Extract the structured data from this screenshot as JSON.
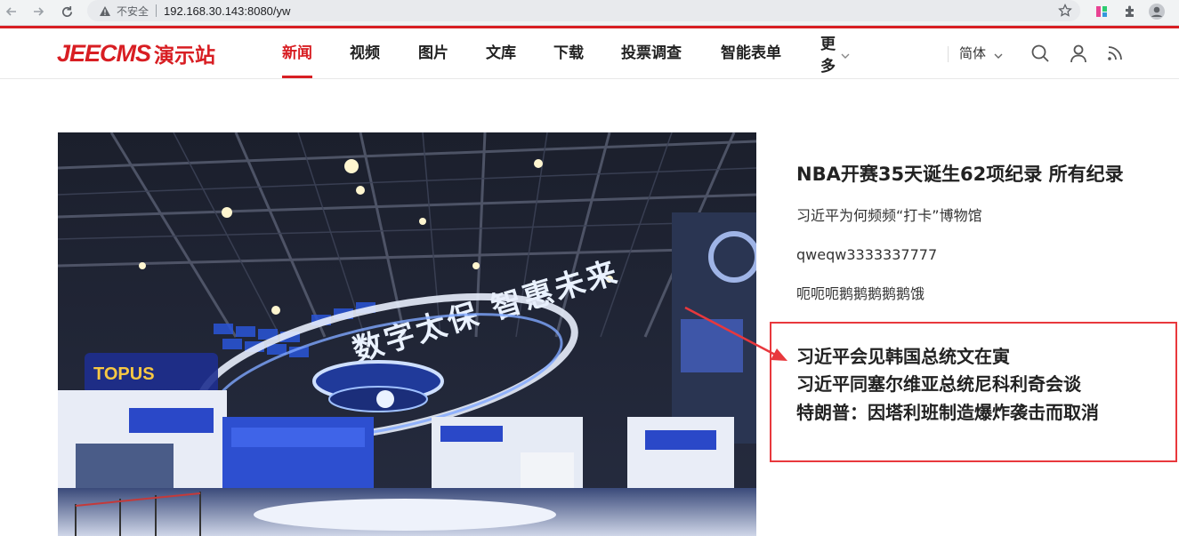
{
  "browser": {
    "security_label": "不安全",
    "url": "192.168.30.143:8080/yw"
  },
  "site": {
    "logo_en": "JEECMS",
    "logo_cn": "演示站",
    "brand_color": "#d81e23"
  },
  "nav": {
    "items": [
      {
        "label": "新闻",
        "active": true
      },
      {
        "label": "视频"
      },
      {
        "label": "图片"
      },
      {
        "label": "文库"
      },
      {
        "label": "下载"
      },
      {
        "label": "投票调查"
      },
      {
        "label": "智能表单"
      },
      {
        "label": "更多"
      }
    ],
    "language": "简体"
  },
  "hero": {
    "sign_text": "数字太保 智惠未来"
  },
  "side": {
    "headline": "NBA开赛35天诞生62项纪录 所有纪录",
    "links": [
      "习近平为何频频“打卡”博物馆",
      "qweqw3333337777",
      "呃呃呃鹅鹅鹅鹅鹅饿"
    ],
    "highlighted": [
      "习近平会见韩国总统文在寅",
      "习近平同塞尔维亚总统尼科利奇会谈",
      "特朗普：因塔利班制造爆炸袭击而取消"
    ]
  }
}
